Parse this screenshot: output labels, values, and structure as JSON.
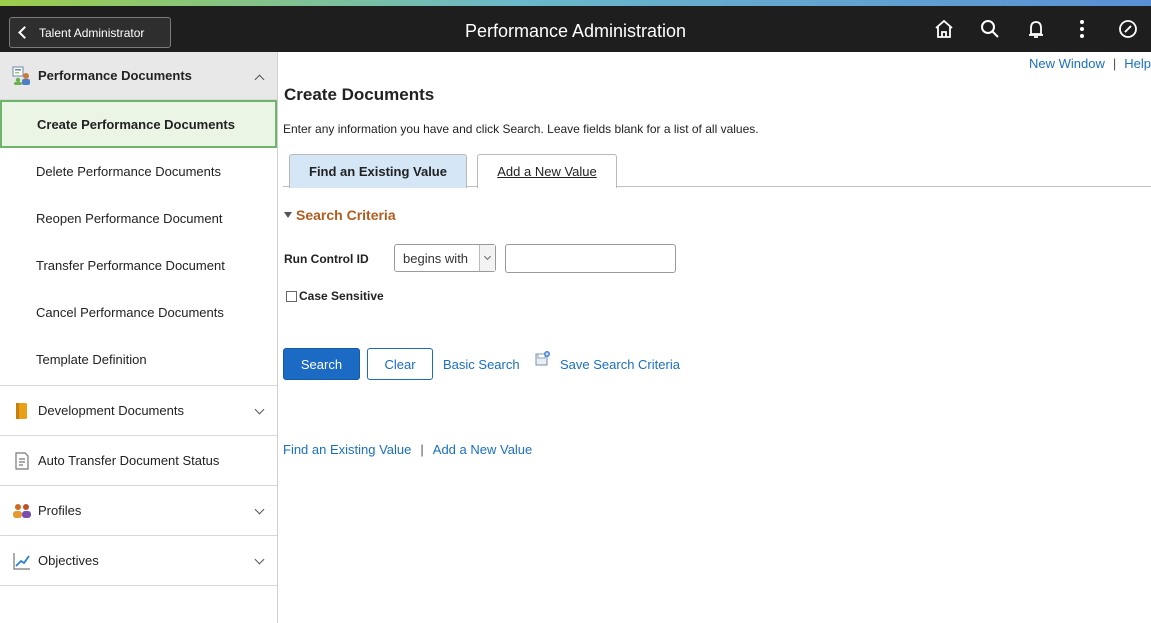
{
  "header": {
    "back_label": "Talent Administrator",
    "title": "Performance Administration",
    "icons": [
      "home-icon",
      "search-icon",
      "bell-icon",
      "more-icon",
      "navbar-icon"
    ]
  },
  "sidebar": {
    "groups": [
      {
        "label": "Performance Documents",
        "icon": "documents-icon",
        "expanded": true,
        "items": [
          {
            "label": "Create Performance Documents",
            "active": true
          },
          {
            "label": "Delete Performance Documents"
          },
          {
            "label": "Reopen Performance Document"
          },
          {
            "label": "Transfer Performance Document"
          },
          {
            "label": "Cancel Performance Documents"
          },
          {
            "label": "Template Definition"
          }
        ]
      },
      {
        "label": "Development Documents",
        "icon": "book-icon",
        "expanded": false
      },
      {
        "label": "Auto Transfer Document Status",
        "icon": "document-icon",
        "expanded": false
      },
      {
        "label": "Profiles",
        "icon": "people-icon",
        "expanded": false
      },
      {
        "label": "Objectives",
        "icon": "chart-icon",
        "expanded": false
      }
    ]
  },
  "main": {
    "links": {
      "new_window": "New Window",
      "help": "Help"
    },
    "title": "Create Documents",
    "instructions": "Enter any information you have and click Search. Leave fields blank for a list of all values.",
    "tabs": [
      {
        "label": "Find an Existing Value",
        "active": true
      },
      {
        "label": "Add a New Value",
        "active": false
      }
    ],
    "search_criteria": {
      "heading": "Search Criteria",
      "field_label": "Run Control ID",
      "operator": "begins with",
      "value": "",
      "case_sensitive_label": "Case Sensitive",
      "case_sensitive": false
    },
    "buttons": {
      "search": "Search",
      "clear": "Clear",
      "basic_search": "Basic Search",
      "save_search": "Save Search Criteria"
    },
    "bottom_links": {
      "find": "Find an Existing Value",
      "add": "Add a New Value"
    }
  },
  "colors": {
    "header_bg": "#1e1e1e",
    "primary_blue": "#1b6ac3",
    "link_blue": "#1a6fc2",
    "section_orange": "#b35c1e",
    "active_nav_border": "#6db56b",
    "active_tab_bg": "#d5e6f6"
  }
}
